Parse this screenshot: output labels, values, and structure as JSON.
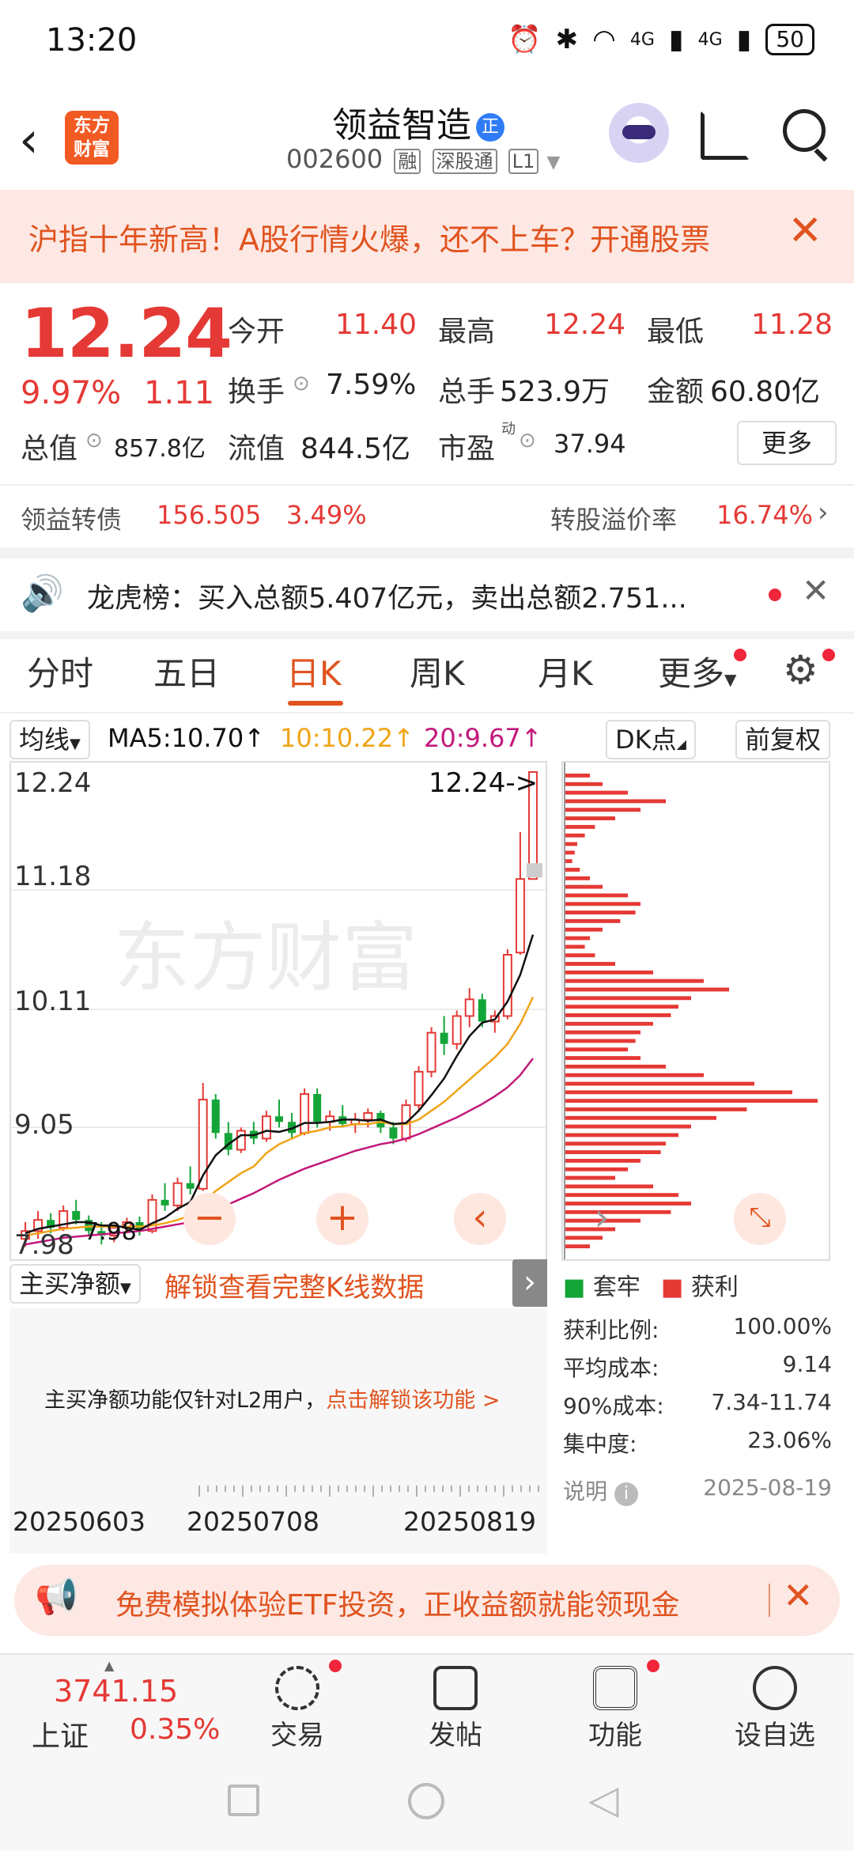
{
  "status": {
    "time": "13:20",
    "battery": "50",
    "net1": "4G",
    "net2": "4G"
  },
  "header": {
    "logo": "东方财富",
    "title": "领益智造",
    "badge": "正",
    "code": "002600",
    "tags": [
      "融",
      "深股通",
      "L1"
    ]
  },
  "banner": {
    "text": "沪指十年新高！A股行情火爆，还不上车？开通股票"
  },
  "quote": {
    "price": "12.24",
    "pct": "9.97%",
    "change": "1.11",
    "open_label": "今开",
    "open": "11.40",
    "high_label": "最高",
    "high": "12.24",
    "low_label": "最低",
    "low": "11.28",
    "turnover_label": "换手",
    "turnover": "7.59%",
    "volume_label": "总手",
    "volume": "523.9万",
    "amount_label": "金额",
    "amount": "60.80亿",
    "mktcap_label": "总值",
    "mktcap": "857.8亿",
    "float_label": "流值",
    "float": "844.5亿",
    "pe_label": "市盈",
    "pe_sup": "动",
    "pe": "37.94",
    "more": "更多"
  },
  "bond": {
    "name": "领益转债",
    "price": "156.505",
    "pct": "3.49%",
    "premium_label": "转股溢价率",
    "premium": "16.74%"
  },
  "notice": {
    "text": "龙虎榜：买入总额5.407亿元，卖出总额2.751..."
  },
  "tabs": [
    "分时",
    "五日",
    "日K",
    "周K",
    "月K",
    "更多"
  ],
  "toolbar": {
    "ma_select": "均线",
    "ma5": "MA5:10.70↑",
    "ma10": "10:10.22↑",
    "ma20": "20:9.67↑",
    "dk": "DK点",
    "adjust": "前复权"
  },
  "colors": {
    "up": "#e53935",
    "down": "#13a538",
    "ma5": "#111111",
    "ma10": "#f0a418",
    "ma20": "#c2187a",
    "accent": "#e0531f"
  },
  "chart_data": {
    "type": "candlestick",
    "y_ticks": [
      "12.24",
      "11.18",
      "10.11",
      "9.05",
      "7.98"
    ],
    "x_ticks": [
      "20250603",
      "20250708",
      "20250819"
    ],
    "last_price_marker": "12.24->",
    "low_marker": "7.98",
    "watermark": "东方财富",
    "ylim": [
      7.98,
      12.24
    ],
    "candles": [
      [
        8.05,
        8.2,
        7.98,
        8.12
      ],
      [
        8.12,
        8.3,
        8.05,
        8.22
      ],
      [
        8.22,
        8.28,
        8.1,
        8.15
      ],
      [
        8.15,
        8.35,
        8.12,
        8.3
      ],
      [
        8.3,
        8.4,
        8.18,
        8.22
      ],
      [
        8.22,
        8.26,
        8.08,
        8.12
      ],
      [
        8.12,
        8.2,
        8.0,
        8.08
      ],
      [
        8.08,
        8.18,
        8.02,
        8.15
      ],
      [
        8.15,
        8.24,
        8.1,
        8.2
      ],
      [
        8.2,
        8.25,
        8.08,
        8.12
      ],
      [
        8.12,
        8.45,
        8.1,
        8.4
      ],
      [
        8.4,
        8.55,
        8.3,
        8.35
      ],
      [
        8.35,
        8.6,
        8.3,
        8.55
      ],
      [
        8.55,
        8.7,
        8.45,
        8.5
      ],
      [
        8.5,
        9.45,
        8.48,
        9.3
      ],
      [
        9.3,
        9.35,
        8.95,
        9.0
      ],
      [
        9.0,
        9.1,
        8.8,
        8.85
      ],
      [
        8.85,
        9.05,
        8.82,
        9.02
      ],
      [
        9.02,
        9.1,
        8.9,
        8.95
      ],
      [
        8.95,
        9.2,
        8.92,
        9.15
      ],
      [
        9.15,
        9.3,
        9.05,
        9.1
      ],
      [
        9.1,
        9.18,
        8.95,
        9.0
      ],
      [
        9.0,
        9.4,
        8.98,
        9.35
      ],
      [
        9.35,
        9.4,
        9.05,
        9.1
      ],
      [
        9.1,
        9.2,
        9.02,
        9.15
      ],
      [
        9.15,
        9.25,
        9.05,
        9.08
      ],
      [
        9.08,
        9.18,
        9.0,
        9.12
      ],
      [
        9.12,
        9.22,
        9.05,
        9.18
      ],
      [
        9.18,
        9.2,
        9.0,
        9.05
      ],
      [
        9.05,
        9.1,
        8.9,
        8.95
      ],
      [
        8.95,
        9.3,
        8.92,
        9.25
      ],
      [
        9.25,
        9.6,
        9.2,
        9.55
      ],
      [
        9.55,
        9.95,
        9.5,
        9.9
      ],
      [
        9.9,
        10.05,
        9.7,
        9.8
      ],
      [
        9.8,
        10.1,
        9.75,
        10.05
      ],
      [
        10.05,
        10.3,
        9.95,
        10.2
      ],
      [
        10.2,
        10.25,
        9.95,
        10.0
      ],
      [
        10.0,
        10.1,
        9.9,
        10.05
      ],
      [
        10.05,
        10.65,
        10.02,
        10.6
      ],
      [
        10.62,
        11.7,
        10.6,
        11.28
      ],
      [
        11.28,
        12.24,
        11.28,
        12.24
      ]
    ],
    "ma5": [
      8.1,
      8.14,
      8.16,
      8.18,
      8.2,
      8.2,
      8.17,
      8.17,
      8.15,
      8.13,
      8.19,
      8.24,
      8.32,
      8.38,
      8.62,
      8.8,
      8.9,
      8.98,
      8.98,
      9.02,
      9.01,
      9.04,
      9.09,
      9.09,
      9.1,
      9.12,
      9.12,
      9.11,
      9.12,
      9.08,
      9.09,
      9.2,
      9.34,
      9.49,
      9.69,
      9.87,
      9.99,
      10.02,
      10.18,
      10.42,
      10.78
    ],
    "ma10": [
      8.08,
      8.1,
      8.12,
      8.14,
      8.15,
      8.16,
      8.16,
      8.16,
      8.16,
      8.16,
      8.17,
      8.19,
      8.22,
      8.26,
      8.38,
      8.48,
      8.56,
      8.64,
      8.7,
      8.82,
      8.9,
      8.95,
      9.0,
      9.02,
      9.05,
      9.06,
      9.08,
      9.08,
      9.1,
      9.08,
      9.08,
      9.12,
      9.2,
      9.28,
      9.38,
      9.48,
      9.58,
      9.68,
      9.8,
      9.98,
      10.22
    ],
    "ma20": [
      8.0,
      8.02,
      8.04,
      8.06,
      8.07,
      8.08,
      8.09,
      8.1,
      8.11,
      8.12,
      8.14,
      8.16,
      8.18,
      8.2,
      8.26,
      8.31,
      8.36,
      8.41,
      8.46,
      8.52,
      8.58,
      8.63,
      8.68,
      8.72,
      8.76,
      8.8,
      8.84,
      8.87,
      8.9,
      8.92,
      8.95,
      8.99,
      9.04,
      9.09,
      9.14,
      9.2,
      9.26,
      9.33,
      9.41,
      9.52,
      9.67
    ]
  },
  "chips": {
    "legend_trapped": "套牢",
    "legend_profit": "获利",
    "rows": [
      {
        "label": "获利比例:",
        "value": "100.00%"
      },
      {
        "label": "平均成本:",
        "value": "9.14"
      },
      {
        "label": "90%成本:",
        "value": "7.34-11.74"
      },
      {
        "label": "集中度:",
        "value": "23.06%"
      }
    ],
    "note": "说明",
    "date": "2025-08-19",
    "profile": [
      0.1,
      0.15,
      0.25,
      0.4,
      0.3,
      0.2,
      0.12,
      0.08,
      0.05,
      0.04,
      0.03,
      0.06,
      0.1,
      0.15,
      0.25,
      0.3,
      0.28,
      0.22,
      0.15,
      0.1,
      0.08,
      0.12,
      0.2,
      0.35,
      0.55,
      0.65,
      0.5,
      0.45,
      0.42,
      0.35,
      0.3,
      0.28,
      0.25,
      0.3,
      0.4,
      0.55,
      0.75,
      0.9,
      1.0,
      0.72,
      0.6,
      0.5,
      0.45,
      0.4,
      0.38,
      0.3,
      0.25,
      0.2,
      0.35,
      0.45,
      0.5,
      0.42,
      0.3,
      0.2,
      0.15,
      0.1
    ]
  },
  "subind": {
    "select": "主买净额",
    "unlock": "解锁查看完整K线数据",
    "msg": "主买净额功能仅针对L2用户，",
    "link": "点击解锁该功能 >"
  },
  "ad": {
    "text": "免费模拟体验ETF投资，正收益额就能领现金"
  },
  "nav": {
    "index_value": "3741.15",
    "index_name": "上证",
    "index_pct": "0.35%",
    "items": [
      "交易",
      "发帖",
      "功能",
      "设自选"
    ]
  }
}
